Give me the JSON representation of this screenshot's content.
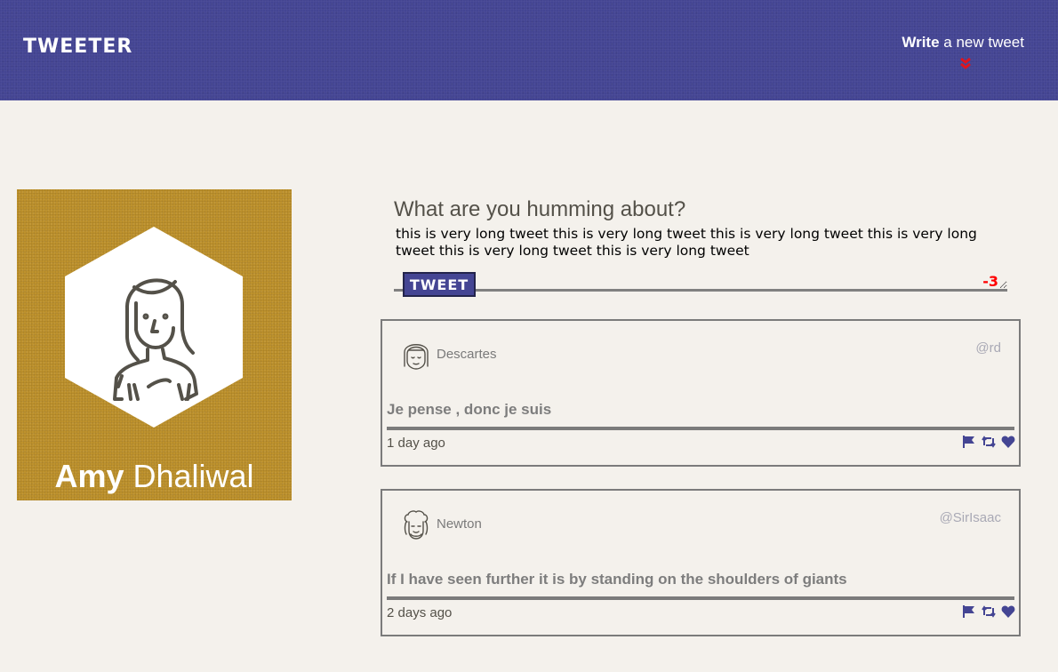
{
  "nav": {
    "brand": "TWEETER",
    "compose_bold": "Write",
    "compose_rest": " a new tweet",
    "compose_icon": "double-chevron-down-icon"
  },
  "profile": {
    "first_name": "Amy",
    "last_name": " Dhaliwal",
    "avatar": "woman-avatar-icon"
  },
  "compose": {
    "label": "What are you humming about?",
    "text": "this is very long tweet this is very long tweet this is very long tweet this is very long tweet this is very long tweet this is very long tweet",
    "button": "TWEET",
    "counter": "-3"
  },
  "tweets": [
    {
      "name": "Descartes",
      "handle": "@rd",
      "content": "Je pense , donc je suis",
      "time": "1 day ago",
      "avatar": "descartes-avatar-icon"
    },
    {
      "name": "Newton",
      "handle": "@SirIsaac",
      "content": "If I have seen further it is by standing on the shoulders of giants",
      "time": "2 days ago",
      "avatar": "newton-avatar-icon"
    }
  ],
  "colors": {
    "nav_bg": "#444593",
    "profile_bg": "#be922d",
    "page_bg": "#f4f1ec",
    "accent": "#444593",
    "counter": "#ff0000"
  }
}
